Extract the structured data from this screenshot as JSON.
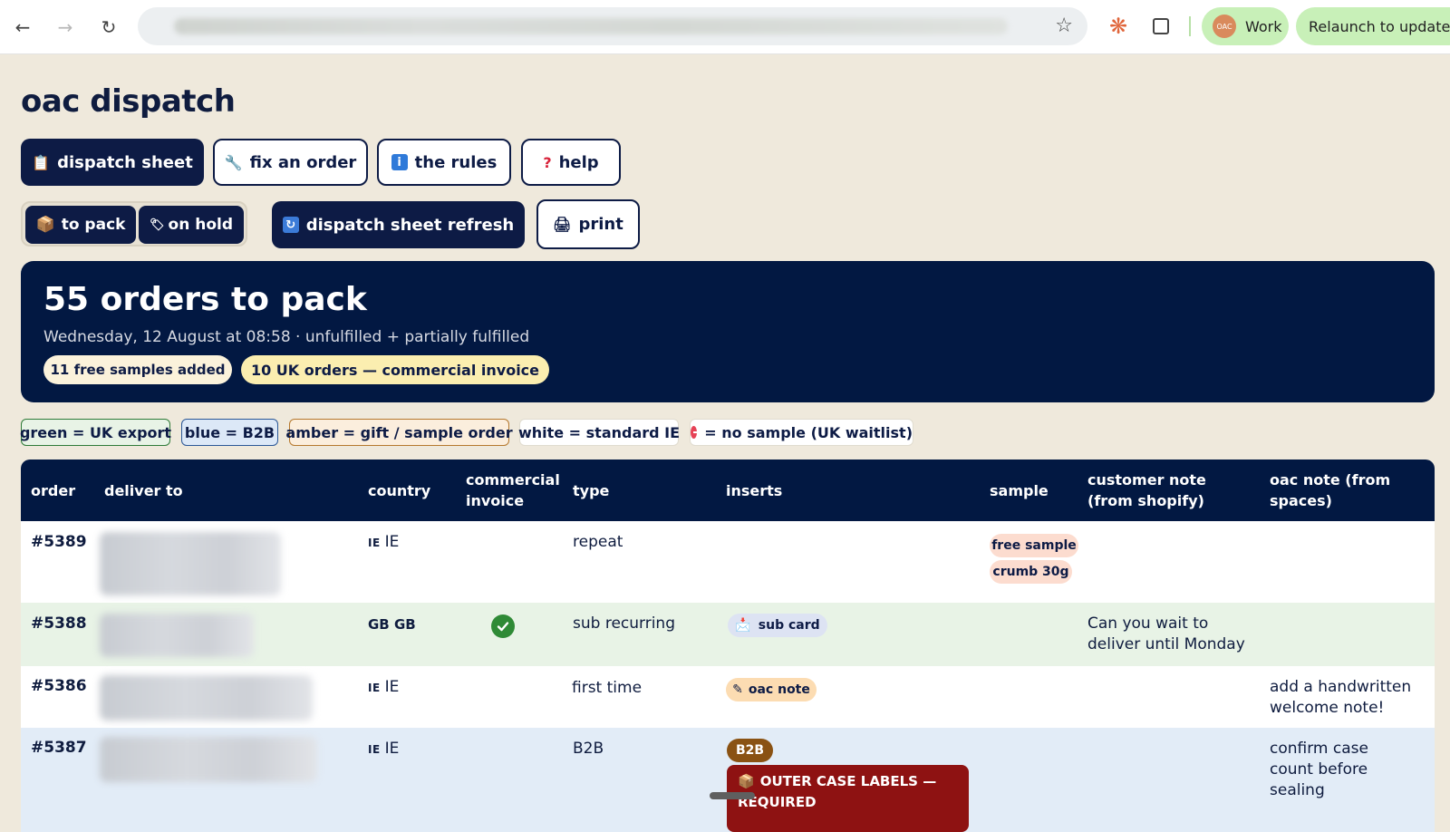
{
  "browser": {
    "profile_label": "Work",
    "profile_avatar_text": "OAC",
    "relaunch_label": "Relaunch to update"
  },
  "page": {
    "title": "oac dispatch"
  },
  "nav": {
    "dispatch_sheet": "dispatch sheet",
    "fix_an_order": "fix an order",
    "the_rules": "the rules",
    "help": "help"
  },
  "actions": {
    "to_pack": "to pack",
    "on_hold": "on hold",
    "refresh": "dispatch sheet refresh",
    "print": "print"
  },
  "banner": {
    "headline": "55 orders to pack",
    "subtitle": "Wednesday, 12 August at 08:58 · unfulfilled + partially fulfilled",
    "samples_pill": "11 free samples added",
    "uk_pill": "10 UK orders — commercial invoice"
  },
  "legend": {
    "green": "green = UK export",
    "blue": "blue = B2B",
    "amber": "amber = gift / sample order",
    "white": "white = standard IE",
    "nosample": "= no sample (UK waitlist)"
  },
  "table": {
    "headers": {
      "order": "order",
      "deliver_to": "deliver to",
      "country": "country",
      "commercial_invoice": "commercial invoice",
      "type": "type",
      "inserts": "inserts",
      "sample": "sample",
      "customer_note": "customer note (from shopify)",
      "oac_note": "oac note (from spaces)"
    },
    "rows": [
      {
        "order": "#5389",
        "flag": "IE",
        "country": "IE",
        "type": "repeat",
        "sample_tags": [
          "free sample",
          "crumb 30g"
        ]
      },
      {
        "order": "#5388",
        "country": "GB GB",
        "commercial_invoice": true,
        "type": "sub recurring",
        "insert": "sub card",
        "customer_note": "Can you wait to deliver until Monday"
      },
      {
        "order": "#5386",
        "flag": "IE",
        "country": "IE",
        "type": "first time",
        "insert": "oac note",
        "oac_note": "add a handwritten welcome note!"
      },
      {
        "order": "#5387",
        "flag": "IE",
        "country": "IE",
        "type": "B2B",
        "insert": "B2B",
        "warning": "OUTER CASE LABELS — REQUIRED",
        "oac_note": "confirm case count before sealing"
      }
    ]
  }
}
